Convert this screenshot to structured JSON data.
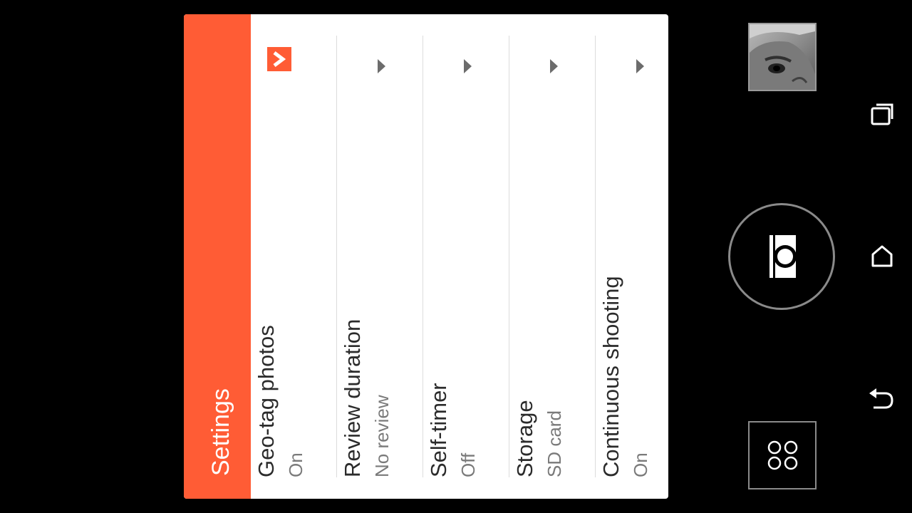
{
  "dialog": {
    "title": "Settings",
    "items": [
      {
        "label": "Geo-tag photos",
        "value": "On",
        "arrow": "chevron-right-icon",
        "selected": true
      },
      {
        "label": "Review duration",
        "value": "No review",
        "arrow": "caret-right-icon",
        "selected": false
      },
      {
        "label": "Self-timer",
        "value": "Off",
        "arrow": "caret-right-icon",
        "selected": false
      },
      {
        "label": "Storage",
        "value": "SD card",
        "arrow": "caret-right-icon",
        "selected": false
      },
      {
        "label": "Continuous shooting",
        "value": "On",
        "arrow": "caret-right-icon",
        "selected": false
      }
    ]
  },
  "controls": {
    "gallery_thumbnail": "photo-thumbnail",
    "shutter": "camera-shutter-icon",
    "modes": "camera-modes-icon"
  },
  "navbar": {
    "recents": "recents-icon",
    "home": "home-icon",
    "back": "back-icon"
  },
  "colors": {
    "accent": "#ff5c35",
    "background": "#000000",
    "dialog_bg": "#ffffff",
    "label_text": "#2b2b2b",
    "value_text": "#7a7a7a"
  }
}
